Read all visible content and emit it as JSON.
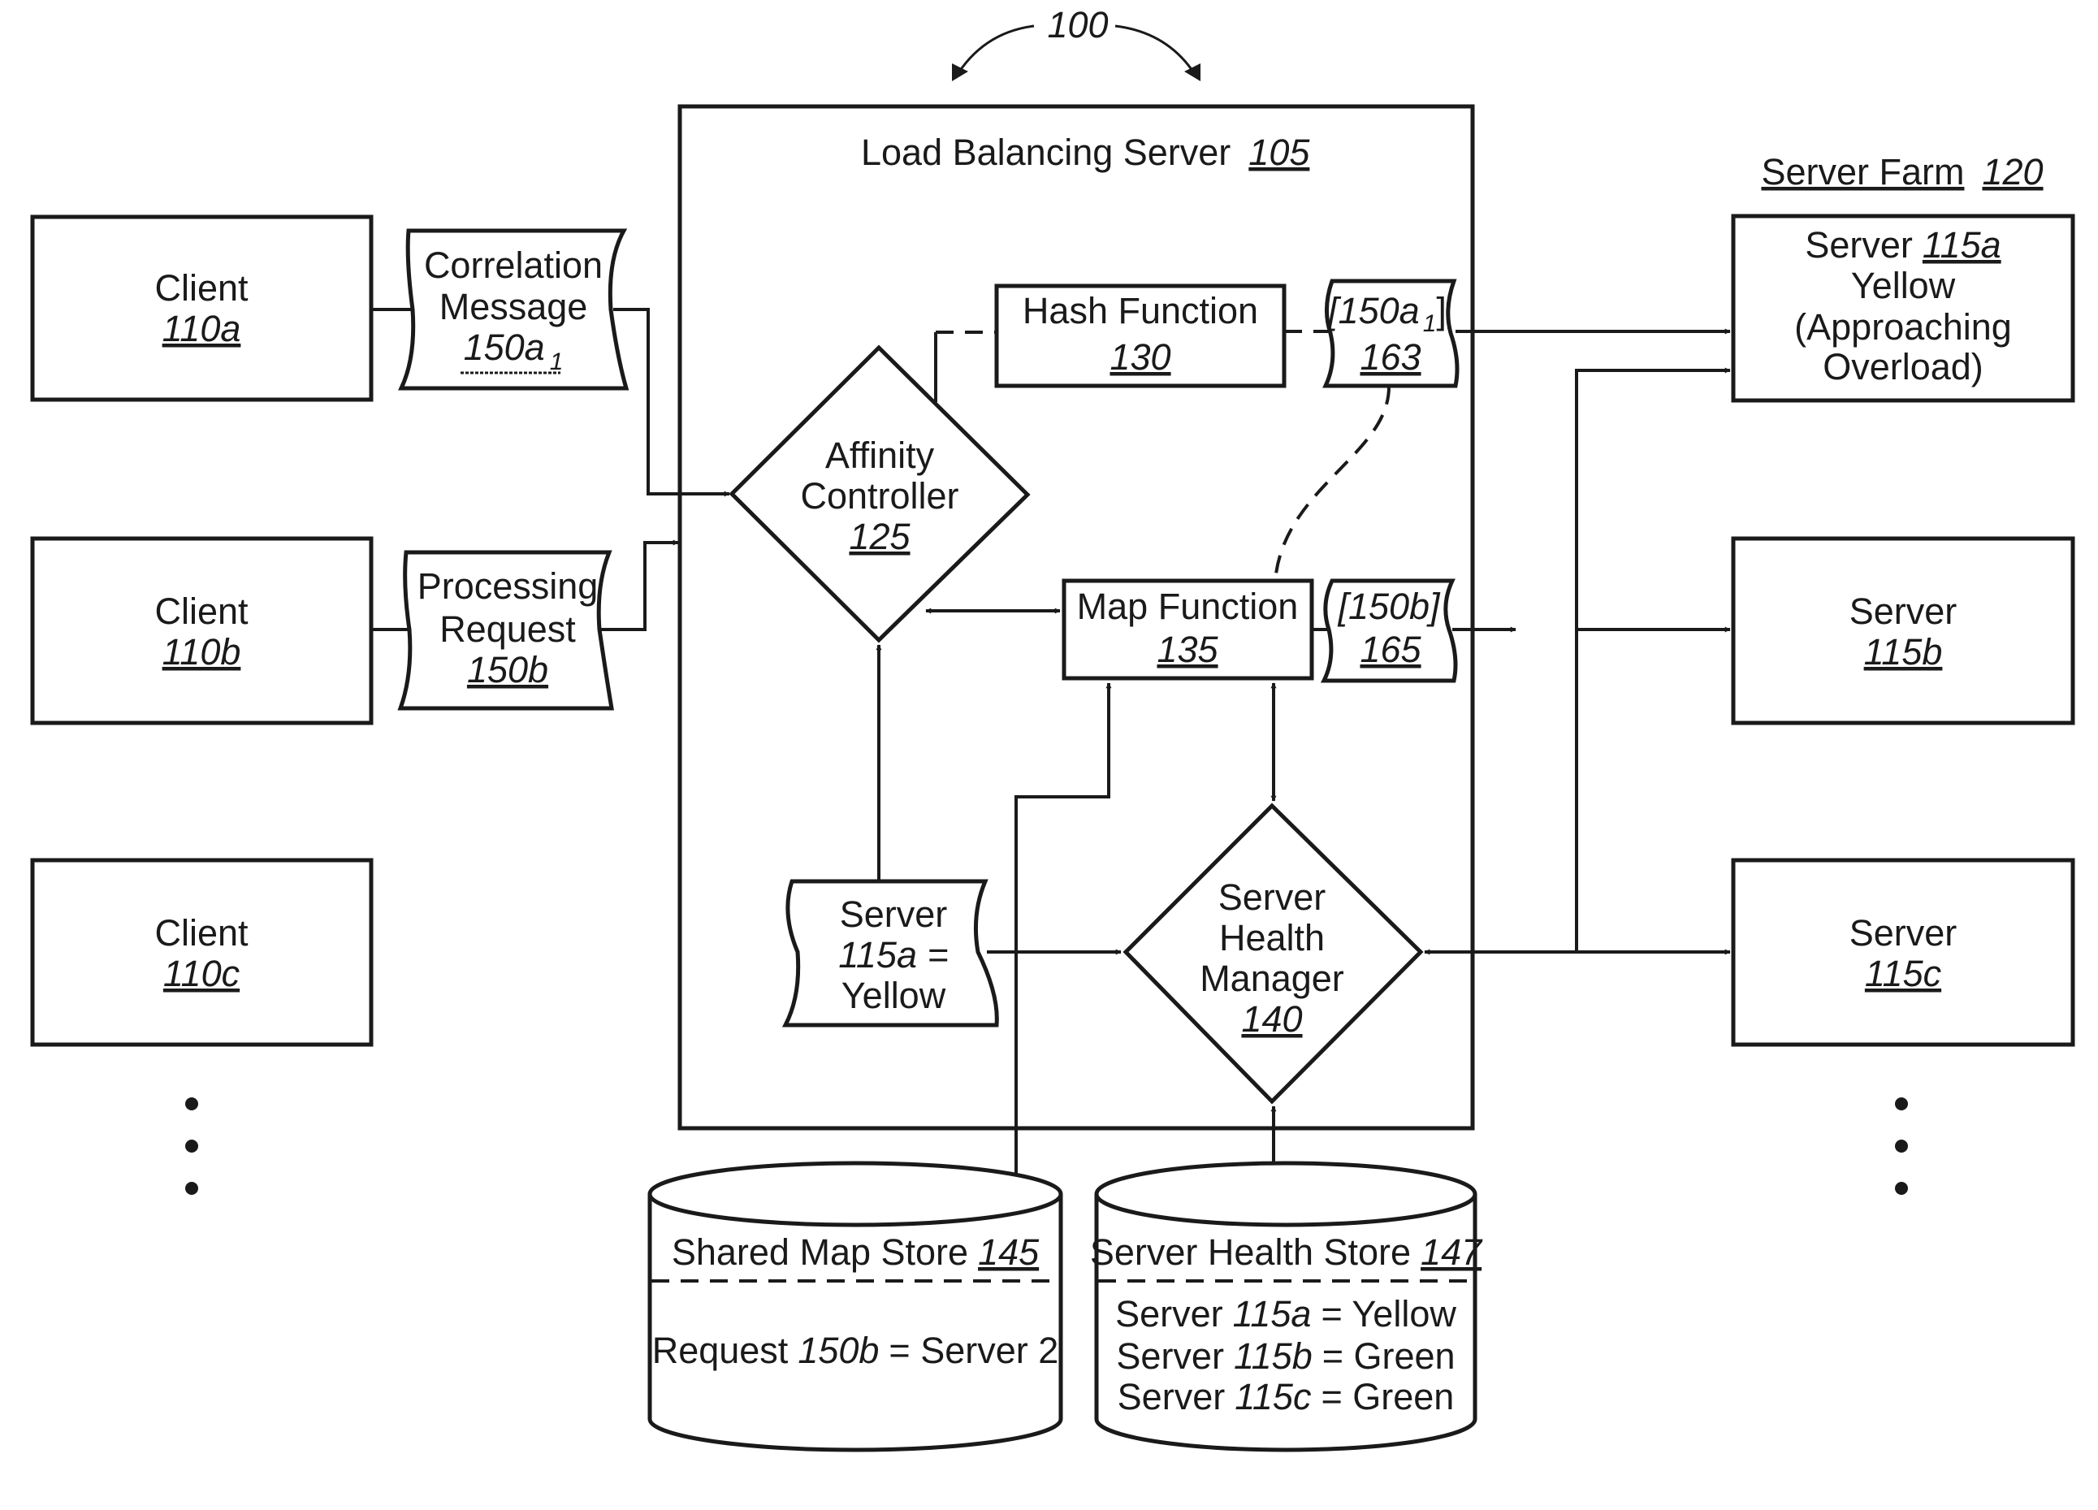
{
  "figure": {
    "ref": "100",
    "load_balancer": {
      "title": "Load Balancing Server",
      "ref": "105"
    },
    "server_farm": {
      "title": "Server Farm",
      "ref": "120"
    },
    "clients": [
      {
        "label": "Client",
        "ref": "110a"
      },
      {
        "label": "Client",
        "ref": "110b"
      },
      {
        "label": "Client",
        "ref": "110c"
      }
    ],
    "messages": {
      "correlation": {
        "line1": "Correlation",
        "line2": "Message",
        "ref": "150a",
        "sub": "1"
      },
      "processing": {
        "line1": "Processing",
        "line2": "Request",
        "ref": "150b"
      }
    },
    "affinity_controller": {
      "line1": "Affinity",
      "line2": "Controller",
      "ref": "125"
    },
    "hash_function": {
      "label": "Hash Function",
      "ref": "130"
    },
    "hash_output": {
      "value": "[150a",
      "sub": "1",
      "close": "]",
      "ref": "163"
    },
    "map_function": {
      "label": "Map Function",
      "ref": "135"
    },
    "map_output": {
      "value": "[150b]",
      "ref": "165"
    },
    "health_manager": {
      "line1": "Server",
      "line2": "Health",
      "line3": "Manager",
      "ref": "140"
    },
    "status_doc": {
      "line1": "Server",
      "line2": "115a =",
      "line3": "Yellow"
    },
    "servers": [
      {
        "label": "Server",
        "ref": "115a",
        "status": "Yellow",
        "note1": "(Approaching",
        "note2": "Overload)"
      },
      {
        "label": "Server",
        "ref": "115b"
      },
      {
        "label": "Server",
        "ref": "115c"
      }
    ],
    "shared_map_store": {
      "title": "Shared Map Store",
      "ref": "145",
      "entry_prefix": "Request",
      "entry_ref": "150b",
      "entry_suffix": "= Server 2"
    },
    "health_store": {
      "title": "Server Health Store",
      "ref": "147",
      "entries": [
        {
          "prefix": "Server",
          "ref": "115a",
          "value": "= Yellow"
        },
        {
          "prefix": "Server",
          "ref": "115b",
          "value": "= Green"
        },
        {
          "prefix": "Server",
          "ref": "115c",
          "value": "= Green"
        }
      ]
    },
    "ellipsis": "•"
  }
}
